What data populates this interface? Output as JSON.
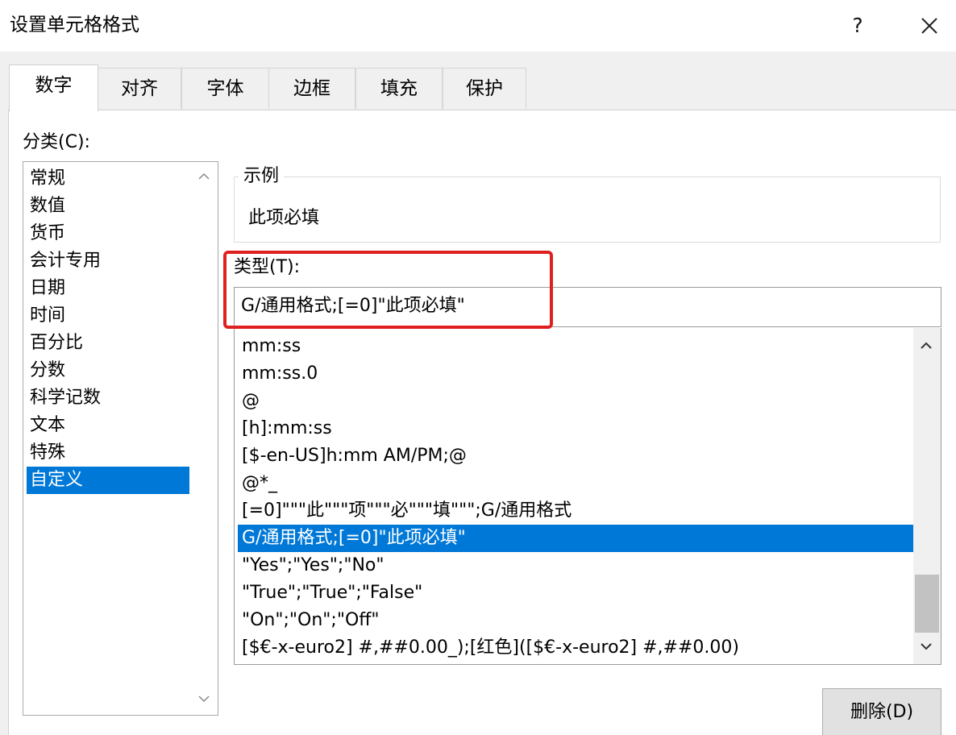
{
  "window": {
    "title": "设置单元格格式",
    "help_label": "?",
    "close_icon": "close-icon"
  },
  "tabs": [
    {
      "label": "数字",
      "active": true
    },
    {
      "label": "对齐",
      "active": false
    },
    {
      "label": "字体",
      "active": false
    },
    {
      "label": "边框",
      "active": false
    },
    {
      "label": "填充",
      "active": false
    },
    {
      "label": "保护",
      "active": false
    }
  ],
  "category": {
    "label": "分类(C):",
    "items": [
      "常规",
      "数值",
      "货币",
      "会计专用",
      "日期",
      "时间",
      "百分比",
      "分数",
      "科学记数",
      "文本",
      "特殊",
      "自定义"
    ],
    "selected": "自定义"
  },
  "sample": {
    "legend": "示例",
    "value": "此项必填"
  },
  "type": {
    "label": "类型(T):",
    "value": "G/通用格式;[=0]\"此项必填\""
  },
  "format_list": {
    "items": [
      "mm:ss",
      "mm:ss.0",
      "@",
      "[h]:mm:ss",
      "[$-en-US]h:mm AM/PM;@",
      "@*_",
      "[=0]\"\"\"此\"\"\"项\"\"\"必\"\"\"填\"\"\";G/通用格式",
      "G/通用格式;[=0]\"此项必填\"",
      "\"Yes\";\"Yes\";\"No\"",
      "\"True\";\"True\";\"False\"",
      "\"On\";\"On\";\"Off\"",
      "[$€-x-euro2] #,##0.00_);[红色]([$€-x-euro2] #,##0.00)"
    ],
    "selected": "G/通用格式;[=0]\"此项必填\""
  },
  "buttons": {
    "delete_label": "删除(D)"
  },
  "colors": {
    "selection": "#0078d7",
    "highlight_annotation": "#e02020"
  }
}
